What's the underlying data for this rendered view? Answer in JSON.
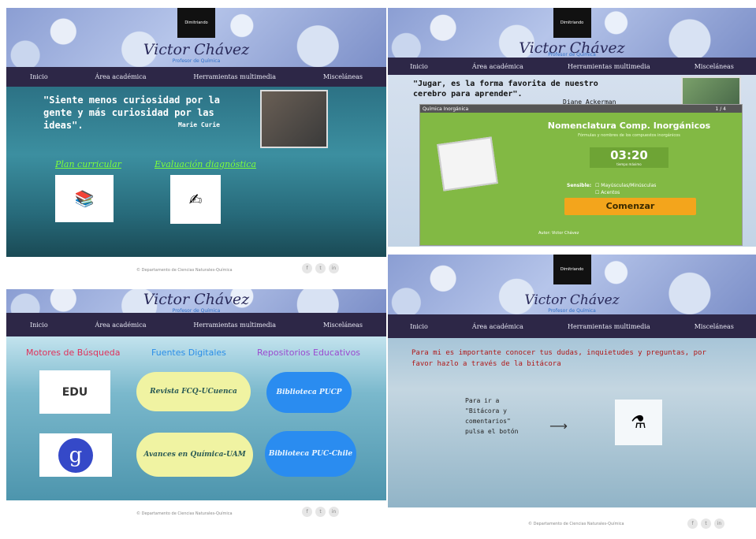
{
  "site": {
    "logo_text": "Dimitriando",
    "name": "Victor Chávez",
    "subtitle": "Profesor de Química"
  },
  "nav": {
    "items": [
      "Inicio",
      "Área académica",
      "Herramientas multimedia",
      "Misceláneas"
    ]
  },
  "footer": {
    "text": "© Departamento de Ciencias Naturales-Química",
    "social": [
      "f",
      "t",
      "in"
    ]
  },
  "panel1": {
    "quote": "\"Siente menos curiosidad por la gente y más curiosidad por las ideas\".",
    "author": "Marie Curie",
    "links": [
      "Plan curricular",
      "Evaluación diagnóstica"
    ]
  },
  "panel2": {
    "quote": "\"Jugar, es la forma favorita de nuestro cerebro para aprender\".",
    "author": "Diane Ackerman",
    "quiz": {
      "bar_title": "Química Inorgánica",
      "title": "Nomenclatura Comp. Inorgánicos",
      "subtitle": "Fórmulas y nombres de los compuestos inorgánicos",
      "timer": "03:20",
      "timer_label": "tiempo máximo",
      "sensible_label": "Sensible:",
      "options": [
        "Mayúsculas/Minúsculas",
        "Acentos"
      ],
      "start_label": "Comenzar",
      "author": "Autor: Victor Chávez",
      "page": "1 / 4"
    }
  },
  "panel3": {
    "categories": [
      "Motores de Búsqueda",
      "Fuentes Digitales",
      "Repositorios Educativos"
    ],
    "category_colors": [
      "#e0305a",
      "#2a8ee8",
      "#9a4ad0"
    ],
    "youtube_label": "EDU",
    "pills": [
      "Revista FCQ-UCuenca",
      "Biblioteca PUCP",
      "Avances en Química-UAM",
      "Biblioteca PUC-Chile"
    ]
  },
  "panel4": {
    "text": "Para mi es importante conocer tus dudas, inquietudes y preguntas, por favor hazlo a través de la bitácora",
    "instruction": "Para ir a \"Bitácora y comentarios\" pulsa el botón"
  }
}
